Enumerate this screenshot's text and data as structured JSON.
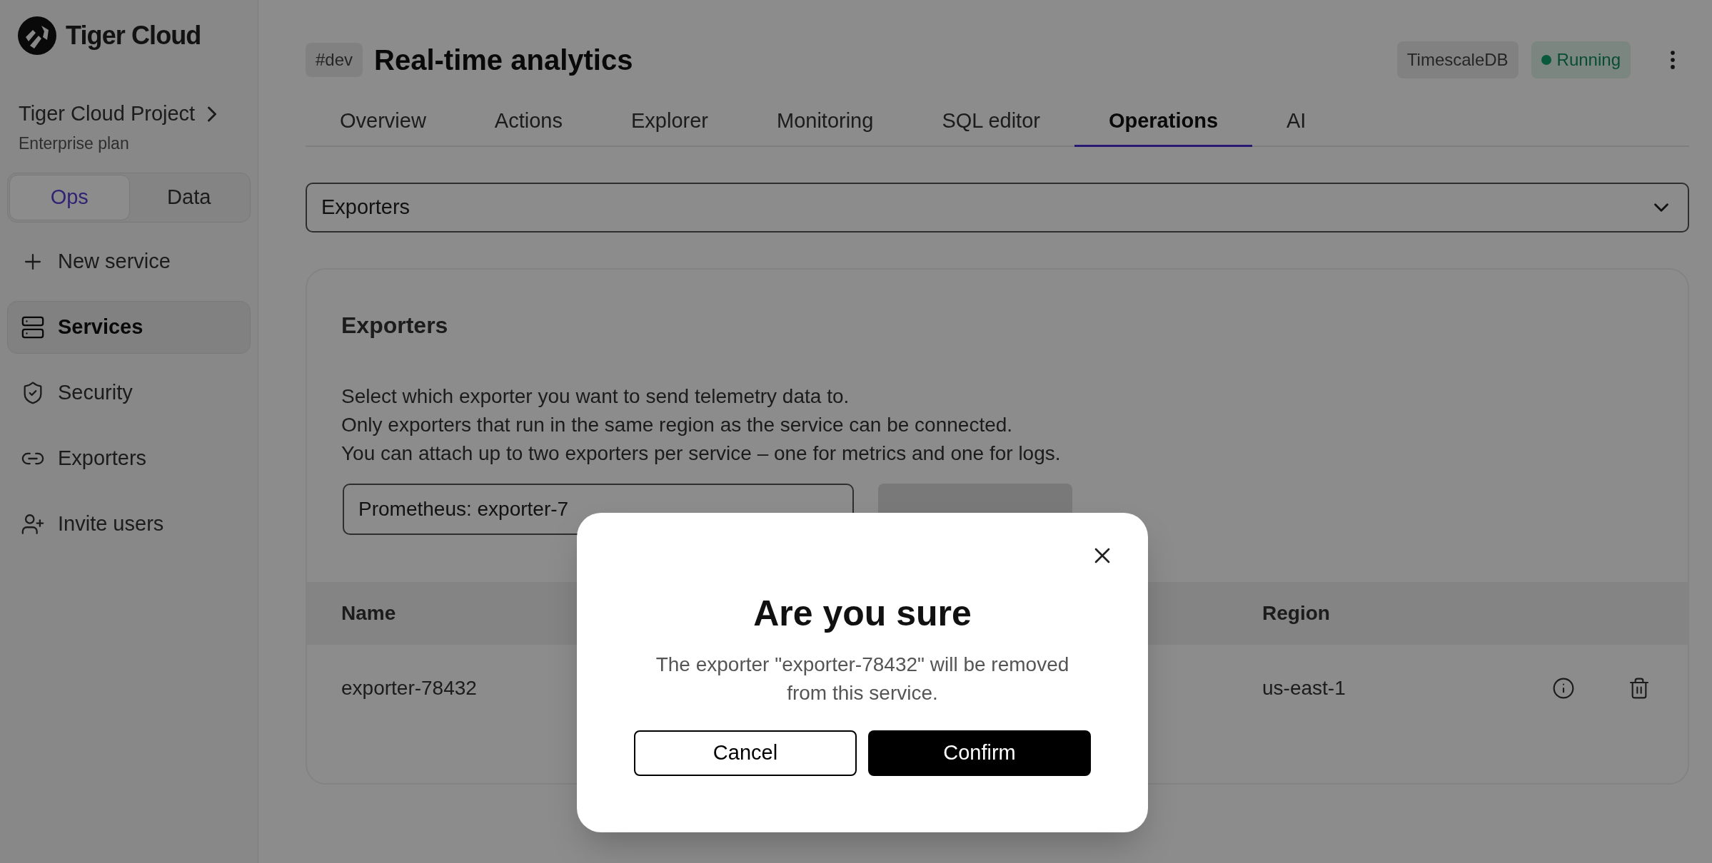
{
  "sidebar": {
    "brand": "Tiger Cloud",
    "project": {
      "name": "Tiger Cloud Project",
      "plan": "Enterprise plan"
    },
    "modes": [
      {
        "label": "Ops",
        "selected": true
      },
      {
        "label": "Data",
        "selected": false
      }
    ],
    "items": [
      {
        "kind": "create",
        "label": "New service",
        "selected": false
      },
      {
        "kind": "services",
        "label": "Services",
        "selected": true
      },
      {
        "kind": "security",
        "label": "Security",
        "selected": false
      },
      {
        "kind": "exporters",
        "label": "Exporters",
        "selected": false
      },
      {
        "kind": "invite",
        "label": "Invite users",
        "selected": false
      }
    ]
  },
  "header": {
    "tag": "#dev",
    "title": "Real-time analytics",
    "engine": "TimescaleDB",
    "status": "Running"
  },
  "tabs": [
    {
      "label": "Overview",
      "selected": false
    },
    {
      "label": "Actions",
      "selected": false
    },
    {
      "label": "Explorer",
      "selected": false
    },
    {
      "label": "Monitoring",
      "selected": false
    },
    {
      "label": "SQL editor",
      "selected": false
    },
    {
      "label": "Operations",
      "selected": true
    },
    {
      "label": "AI",
      "selected": false
    }
  ],
  "section_select": {
    "value": "Exporters"
  },
  "card": {
    "title": "Exporters",
    "description": [
      "Select which exporter you want to send telemetry data to.",
      "Only exporters that run in the same region as the service can be connected.",
      "You can attach up to two exporters per service – one for metrics and one for logs."
    ],
    "exporter_select": {
      "value": "Prometheus: exporter-7"
    },
    "attach_button": {
      "disabled": true
    },
    "table": {
      "columns": [
        "Name",
        "Region"
      ],
      "rows": [
        {
          "name": "exporter-78432",
          "region": "us-east-1"
        }
      ]
    }
  },
  "dialog": {
    "title": "Are you sure",
    "message": "The exporter \"exporter-78432\" will be removed from this service.",
    "buttons": [
      {
        "kind": "secondary",
        "label": "Cancel"
      },
      {
        "kind": "primary",
        "label": "Confirm"
      }
    ]
  }
}
